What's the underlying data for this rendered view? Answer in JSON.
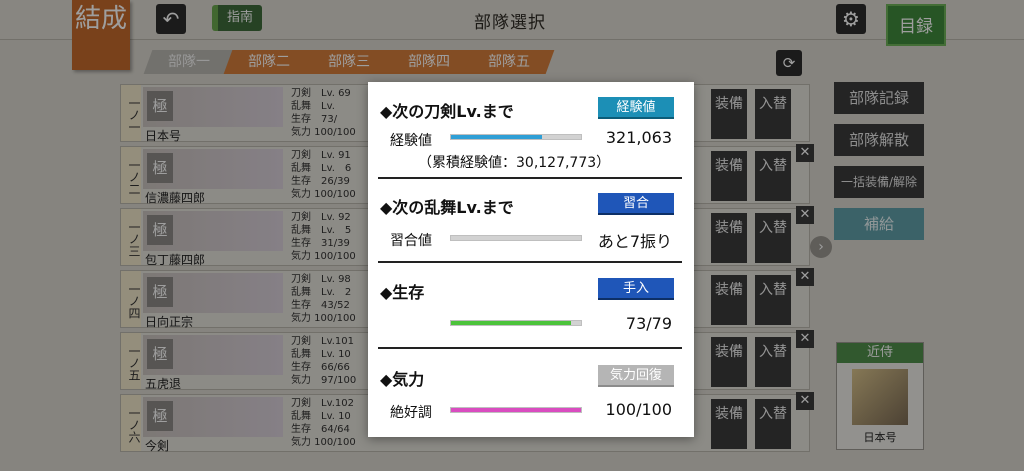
{
  "header": {
    "kessei": "結成",
    "title": "部隊選択",
    "guide_label": "指南",
    "catalog_label": "目録"
  },
  "tabs": [
    "部隊一",
    "部隊二",
    "部隊三",
    "部隊四",
    "部隊五"
  ],
  "units": [
    {
      "num": "一ノ一",
      "tag": "極",
      "name": "日本号",
      "stats": [
        "刀剣　Lv. 69",
        "乱舞　Lv.",
        "生存　73/",
        "気力 100/100"
      ]
    },
    {
      "num": "一ノ二",
      "tag": "極",
      "name": "信濃藤四郎",
      "stats": [
        "刀剣　Lv. 91",
        "乱舞　Lv.　6",
        "生存　26/39",
        "気力 100/100"
      ]
    },
    {
      "num": "一ノ三",
      "tag": "極",
      "name": "包丁藤四郎",
      "stats": [
        "刀剣　Lv. 92",
        "乱舞　Lv.　5",
        "生存　31/39",
        "気力 100/100"
      ]
    },
    {
      "num": "一ノ四",
      "tag": "極",
      "name": "日向正宗",
      "stats": [
        "刀剣　Lv. 98",
        "乱舞　Lv.　2",
        "生存　43/52",
        "気力 100/100"
      ]
    },
    {
      "num": "一ノ五",
      "tag": "極",
      "name": "五虎退",
      "stats": [
        "刀剣　Lv.101",
        "乱舞　Lv. 10",
        "生存　66/66",
        "気力　97/100"
      ]
    },
    {
      "num": "一ノ六",
      "tag": "極",
      "name": "今剣",
      "stats": [
        "刀剣　Lv.102",
        "乱舞　Lv. 10",
        "生存　64/64",
        "気力 100/100"
      ]
    }
  ],
  "row_buttons": {
    "equip": "装備",
    "swap": "入替"
  },
  "side": {
    "record": "部隊記録",
    "disband": "部隊解散",
    "bulk": "一括装備/解除",
    "supply": "補給"
  },
  "attendant": {
    "label": "近侍",
    "name": "日本号"
  },
  "popup": {
    "exp": {
      "title": "◆次の刀剣Lv.まで",
      "button": "経験値",
      "label": "経験値",
      "value": "321,063",
      "cumulative": "（累積経験値：30,127,773）",
      "fill": 0.7
    },
    "ranbu": {
      "title": "◆次の乱舞Lv.まで",
      "button": "習合",
      "label": "習合値",
      "value": "あと7振り",
      "fill": 0
    },
    "survival": {
      "title": "◆生存",
      "button": "手入",
      "value": "73/79",
      "fill": 0.924
    },
    "spirit": {
      "title": "◆気力",
      "button": "気力回復",
      "label": "絶好調",
      "value": "100/100",
      "fill": 1.0
    }
  },
  "colors": {
    "exp_fill": "#2f9fd6",
    "survival_fill": "#4cc33b",
    "spirit_fill": "#d94cc0",
    "tab_orange": "#d37d3a",
    "accent_green": "#3f8a3c"
  }
}
